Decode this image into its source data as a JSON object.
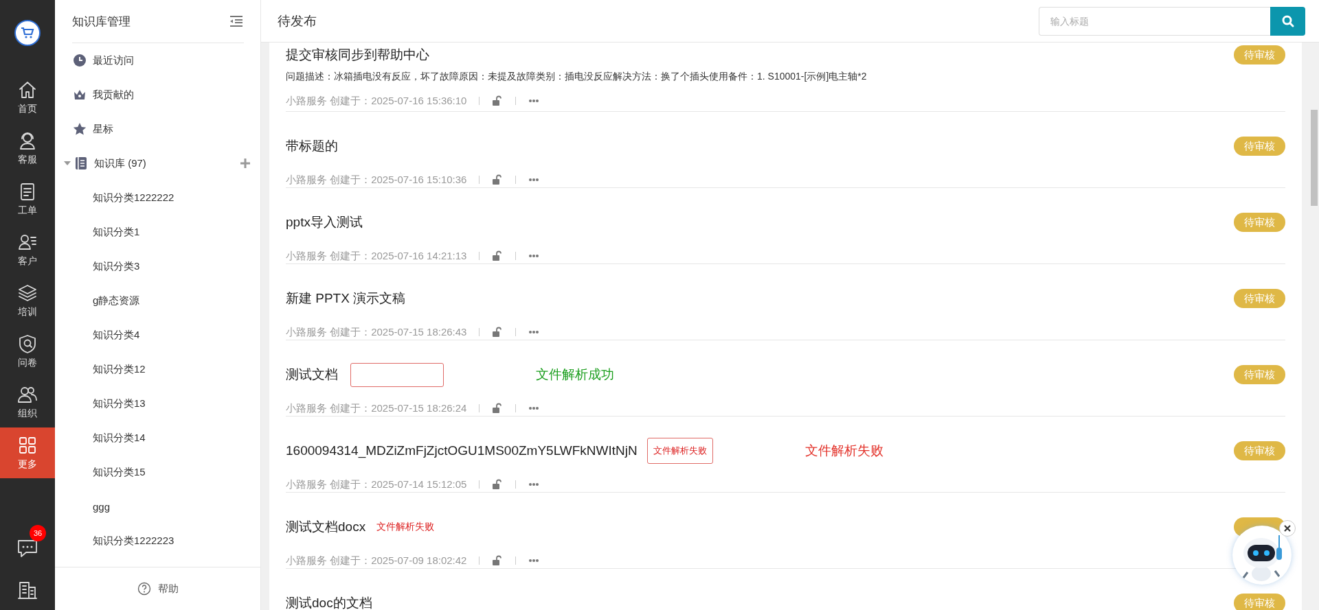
{
  "nav": {
    "items": [
      {
        "label": "首页",
        "selected": false
      },
      {
        "label": "客服",
        "selected": false
      },
      {
        "label": "工单",
        "selected": false
      },
      {
        "label": "客户",
        "selected": false
      },
      {
        "label": "培训",
        "selected": false
      },
      {
        "label": "问卷",
        "selected": false
      },
      {
        "label": "组织",
        "selected": false
      },
      {
        "label": "更多",
        "selected": true
      }
    ],
    "chat_badge": "36"
  },
  "sidebar": {
    "title": "知识库管理",
    "links": [
      {
        "label": "最近访问"
      },
      {
        "label": "我贡献的"
      },
      {
        "label": "星标"
      }
    ],
    "tree": {
      "label": "知识库 (97)",
      "expanded": true,
      "children": [
        {
          "label": "知识分类1222222"
        },
        {
          "label": "知识分类1"
        },
        {
          "label": "知识分类3"
        },
        {
          "label": "g静态资源"
        },
        {
          "label": "知识分类4"
        },
        {
          "label": "知识分类12"
        },
        {
          "label": "知识分类13"
        },
        {
          "label": "知识分类14"
        },
        {
          "label": "知识分类15"
        },
        {
          "label": "ggg"
        },
        {
          "label": "知识分类1222223"
        }
      ]
    },
    "help": "帮助"
  },
  "main": {
    "title": "待发布",
    "search": {
      "placeholder": "输入标题"
    },
    "rows": [
      {
        "title": "提交审核同步到帮助中心",
        "description": "问题描述：冰箱插电没有反应，坏了故障原因：未提及故障类别：插电没反应解决方法：换了个插头使用备件：1. S10001-[示例]电主轴*2",
        "meta": "小路服务 创建于：2025-07-16 15:36:10",
        "badge": "待审核"
      },
      {
        "title": "带标题的",
        "meta": "小路服务 创建于：2025-07-16 15:10:36",
        "badge": "待审核"
      },
      {
        "title": "pptx导入测试",
        "meta": "小路服务 创建于：2025-07-16 14:21:13",
        "badge": "待审核"
      },
      {
        "title": "新建 PPTX 演示文稿",
        "meta": "小路服务 创建于：2025-07-15 18:26:43",
        "badge": "待审核"
      },
      {
        "title": "测试文档",
        "tags": [
          {
            "kind": "empty-box"
          },
          {
            "kind": "note",
            "text": "文件解析成功",
            "color": "#1a9e1c"
          }
        ],
        "meta": "小路服务 创建于：2025-07-15 18:26:24",
        "badge": "待审核"
      },
      {
        "title": "1600094314_MDZiZmFjZjctOGU1MS00ZmY5LWFkNWItNjN",
        "tags": [
          {
            "kind": "boxed",
            "text": "文件解析失败"
          },
          {
            "kind": "note",
            "text": "文件解析失败",
            "color": "#e3322a"
          }
        ],
        "meta": "小路服务 创建于：2025-07-14 15:12:05",
        "badge": "待审核"
      },
      {
        "title": "测试文档docx",
        "tags": [
          {
            "kind": "plain",
            "text": "文件解析失败"
          }
        ],
        "meta": "小路服务 创建于：2025-07-09 18:02:42",
        "badge_covered": true
      },
      {
        "title": "测试doc的文档",
        "badge": "待审核"
      }
    ]
  }
}
